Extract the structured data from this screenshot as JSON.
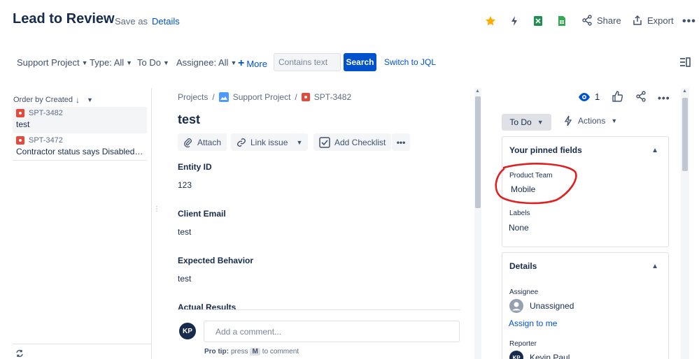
{
  "header": {
    "title": "Lead to Review",
    "save_as": "Save as",
    "details": "Details",
    "share": "Share",
    "export": "Export",
    "accent_color": "#0052cc",
    "star_color": "#ffab00",
    "excel_color": "#1d8f4e",
    "sheets_color": "#34a853"
  },
  "filters": {
    "project": "Support Project",
    "type": "Type: All",
    "status": "To Do",
    "assignee": "Assignee: All",
    "more": "More",
    "text_placeholder": "Contains text",
    "search": "Search",
    "switch_jql": "Switch to JQL"
  },
  "list": {
    "order": "Order by Created",
    "items": [
      {
        "key": "SPT-3482",
        "summary": "test",
        "selected": true
      },
      {
        "key": "SPT-3472",
        "summary": "Contractor status says Disabled and...",
        "selected": false
      }
    ]
  },
  "issue": {
    "breadcrumbs": [
      "Projects",
      "Support Project",
      "SPT-3482"
    ],
    "title": "test",
    "toolbar": {
      "attach": "Attach",
      "link_issue": "Link issue",
      "add_checklist": "Add Checklist"
    },
    "fields": [
      {
        "label": "Entity ID",
        "value": "123"
      },
      {
        "label": "Client Email",
        "value": "test"
      },
      {
        "label": "Expected Behavior",
        "value": "test"
      },
      {
        "label": "Actual Results",
        "value": ""
      }
    ],
    "comment": {
      "avatar_initials": "KP",
      "placeholder": "Add a comment...",
      "protip_prefix": "Pro tip:",
      "protip_press": "press",
      "protip_key": "M",
      "protip_suffix": "to comment"
    }
  },
  "side": {
    "watchers": "1",
    "status": "To Do",
    "actions": "Actions",
    "pinned": {
      "title": "Your pinned fields",
      "product_team_label": "Product Team",
      "product_team_value": "Mobile",
      "labels_label": "Labels",
      "labels_value": "None",
      "annotation_color": "#e02020"
    },
    "details": {
      "title": "Details",
      "assignee_label": "Assignee",
      "assignee_value": "Unassigned",
      "assign_to_me": "Assign to me",
      "reporter_label": "Reporter",
      "reporter_initials": "KP",
      "reporter_value": "Kevin Paul"
    }
  }
}
